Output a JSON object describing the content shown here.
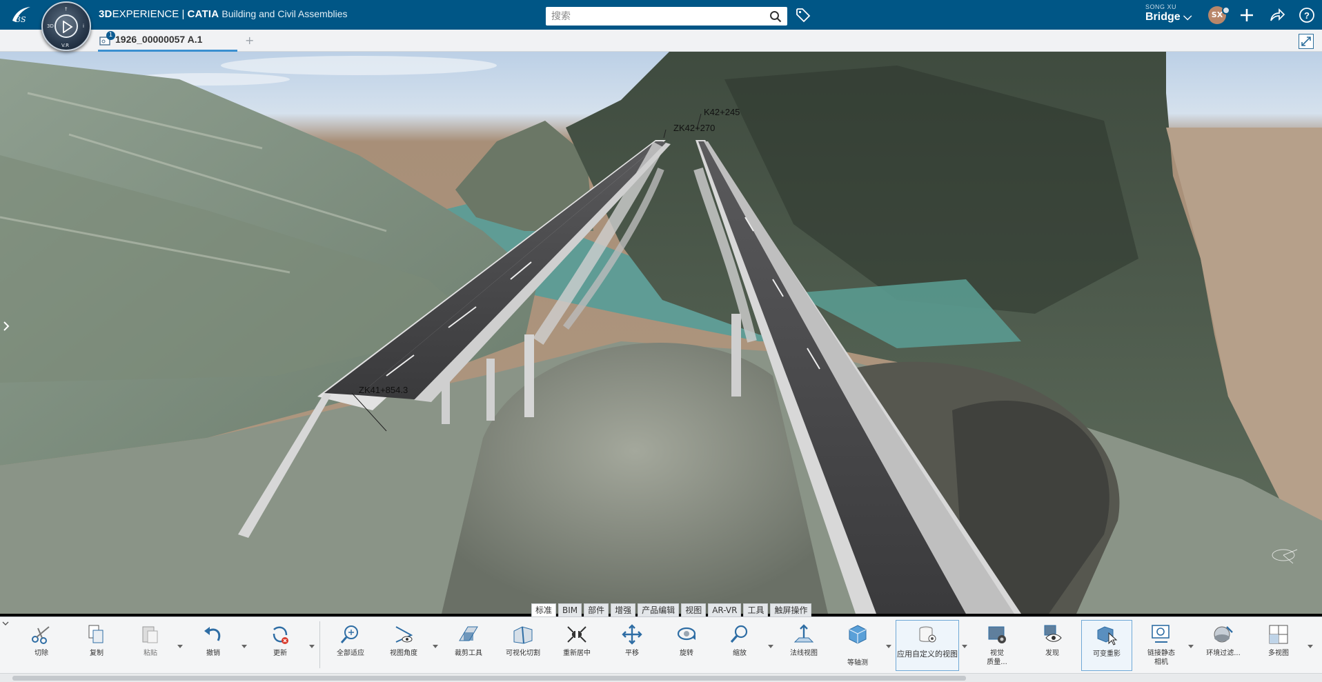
{
  "header": {
    "brand_bold": "3D",
    "brand_rest": "EXPERIENCE | ",
    "product": "CATIA",
    "app_name": "Building and Civil Assemblies",
    "compass": {
      "label_3d": "3D",
      "label_vr": "V.R",
      "label_i": "i",
      "label_top": "†"
    },
    "search_placeholder": "搜索",
    "user_name": "SONG XU",
    "collab_space": "Bridge ⌵",
    "avatar_initials": "SX",
    "icons": [
      "ds-logo-icon",
      "compass-icon",
      "search-icon",
      "tag-icon",
      "add-icon",
      "share-icon",
      "help-icon"
    ],
    "brand_color": "#005686"
  },
  "tabs": {
    "document_tab": "1926_00000057 A.1",
    "badge": "1",
    "new_tab": "+"
  },
  "viewport": {
    "annotations": [
      "K42+245",
      "ZK42+270",
      "ZK41+854.3"
    ]
  },
  "category_tabs": [
    "标准",
    "BIM",
    "部件",
    "增强",
    "产品编辑",
    "视图",
    "AR-VR",
    "工具",
    "触屏操作"
  ],
  "active_category": "标准",
  "toolbar": {
    "cut": "切除",
    "copy": "复制",
    "paste": "粘贴",
    "undo": "撤销",
    "update": "更新",
    "fit_all": "全部适应",
    "view_angle": "视图角度",
    "clip_tool": "裁剪工具",
    "visual_clip": "可视化切割",
    "recenter": "重新居中",
    "pan": "平移",
    "rotate": "旋转",
    "zoom": "缩放",
    "normal_view": "法线视图",
    "isometric": "等轴测",
    "custom_view": "应用自定义的视图",
    "visual_quality_1": "视觉",
    "visual_quality_2": "质量...",
    "reveal": "发现",
    "ghosting": "可变重影",
    "link_camera_1": "链接静态",
    "link_camera_2": "相机",
    "env_filter": "环境过滤...",
    "multi_view": "多视图"
  }
}
